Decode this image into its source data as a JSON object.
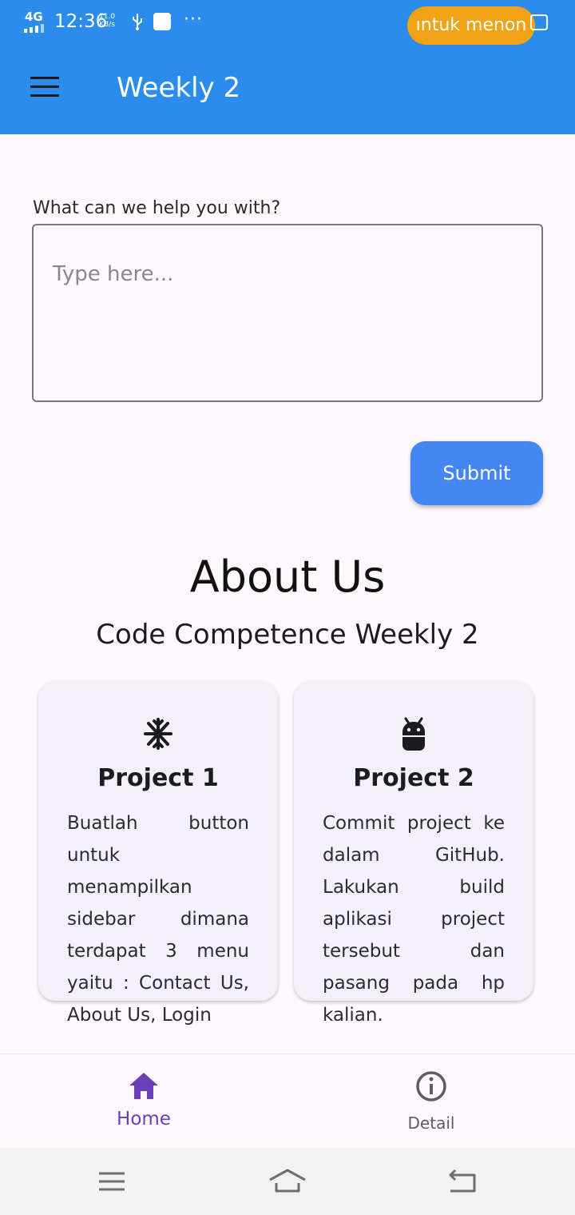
{
  "status_bar": {
    "network": "4G",
    "time": "12:36",
    "speed_value": "11.0",
    "speed_unit": "KB/s",
    "more": "···",
    "toast": "ıntuk menon"
  },
  "app_bar": {
    "title": "Weekly 2",
    "color": "#2b8ceb"
  },
  "form": {
    "label": "What can we help you with?",
    "placeholder": "Type here...",
    "value": "",
    "submit_label": "Submit"
  },
  "about": {
    "title": "About Us",
    "subtitle": "Code Competence Weekly 2"
  },
  "cards": [
    {
      "icon": "snowflake-icon",
      "title": "Project 1",
      "text": "Buatlah button untuk menampilkan sidebar dimana terdapat 3 menu yaitu : Contact Us, About Us, Login"
    },
    {
      "icon": "android-icon",
      "title": "Project 2",
      "text": "Commit project ke dalam GitHub. Lakukan build aplikasi project tersebut dan pasang pada hp kalian."
    }
  ],
  "bottom_nav": {
    "items": [
      {
        "label": "Home",
        "icon": "home-icon",
        "selected": true
      },
      {
        "label": "Detail",
        "icon": "info-icon",
        "selected": false
      }
    ],
    "accent": "#6b3fb8"
  },
  "system_nav": {
    "icons": [
      "recents-icon",
      "home-icon",
      "back-icon"
    ]
  }
}
